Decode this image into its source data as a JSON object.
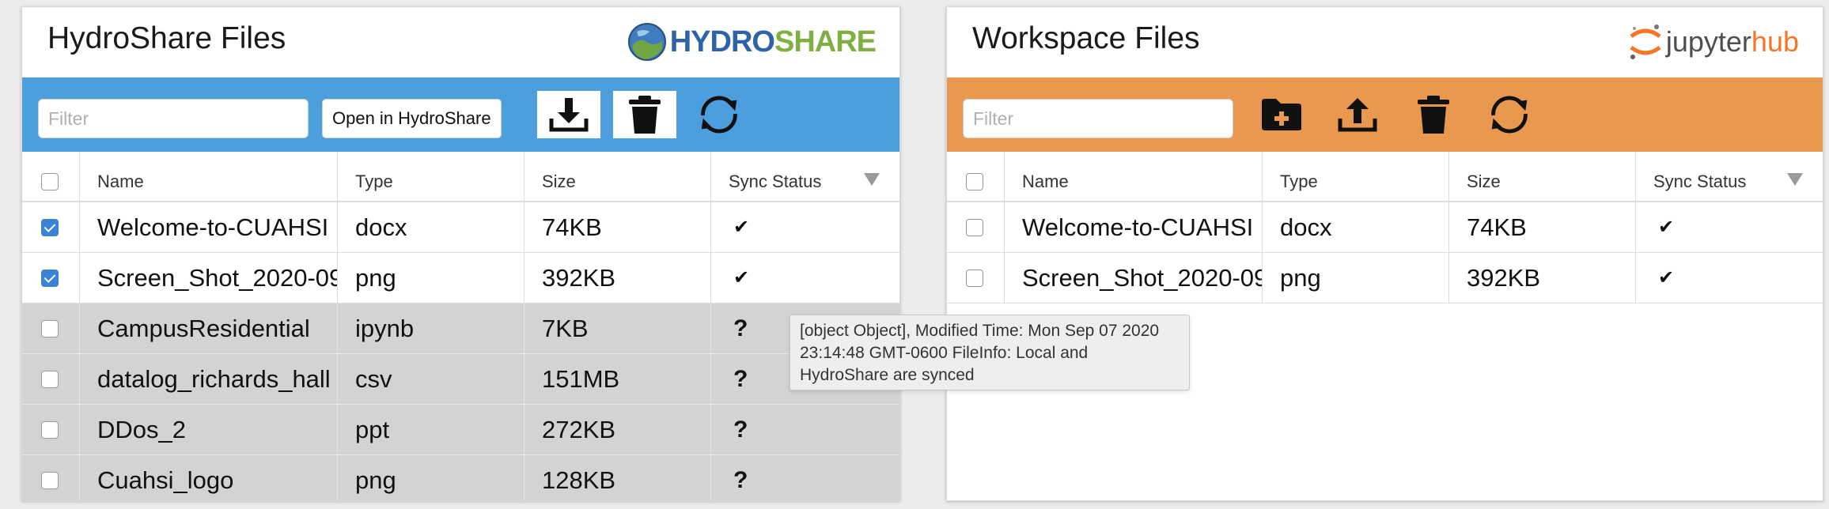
{
  "left": {
    "title": "HydroShare Files",
    "logo": {
      "part1": "HYDRO",
      "part2": "SHARE",
      "color1": "#2f63a8",
      "color2": "#7fb041"
    },
    "accent": "#4c9fdc",
    "filter_placeholder": "Filter",
    "open_button": "Open in HydroShare",
    "icons": [
      "download-icon",
      "trash-icon",
      "sync-icon"
    ],
    "columns": {
      "name": "Name",
      "type": "Type",
      "size": "Size",
      "status": "Sync Status"
    },
    "rows": [
      {
        "name": "Welcome-to-CUAHSI",
        "type": "docx",
        "size": "74KB",
        "status": "✔",
        "checked": true,
        "gray": false
      },
      {
        "name": "Screen_Shot_2020-09",
        "type": "png",
        "size": "392KB",
        "status": "✔",
        "checked": true,
        "gray": false
      },
      {
        "name": "CampusResidential",
        "type": "ipynb",
        "size": "7KB",
        "status": "?",
        "checked": false,
        "gray": true
      },
      {
        "name": "datalog_richards_hall",
        "type": "csv",
        "size": "151MB",
        "status": "?",
        "checked": false,
        "gray": true
      },
      {
        "name": "DDos_2",
        "type": "ppt",
        "size": "272KB",
        "status": "?",
        "checked": false,
        "gray": true
      },
      {
        "name": "Cuahsi_logo",
        "type": "png",
        "size": "128KB",
        "status": "?",
        "checked": false,
        "gray": true
      }
    ]
  },
  "right": {
    "title": "Workspace Files",
    "logo": {
      "part1": "jupyter",
      "part2": "hub",
      "color1": "#4e4e4e",
      "color2": "#f37726"
    },
    "accent": "#e8994f",
    "filter_placeholder": "Filter",
    "icons": [
      "new-folder-icon",
      "upload-icon",
      "trash-icon",
      "sync-icon"
    ],
    "columns": {
      "name": "Name",
      "type": "Type",
      "size": "Size",
      "status": "Sync Status"
    },
    "rows": [
      {
        "name": "Welcome-to-CUAHSI",
        "type": "docx",
        "size": "74KB",
        "status": "✔",
        "checked": false,
        "gray": false
      },
      {
        "name": "Screen_Shot_2020-09",
        "type": "png",
        "size": "392KB",
        "status": "✔",
        "checked": false,
        "gray": false
      }
    ]
  },
  "tooltip": {
    "text": "[object Object], Modified Time: Mon Sep 07 2020 23:14:48 GMT-0600 FileInfo: Local and HydroShare are synced"
  }
}
